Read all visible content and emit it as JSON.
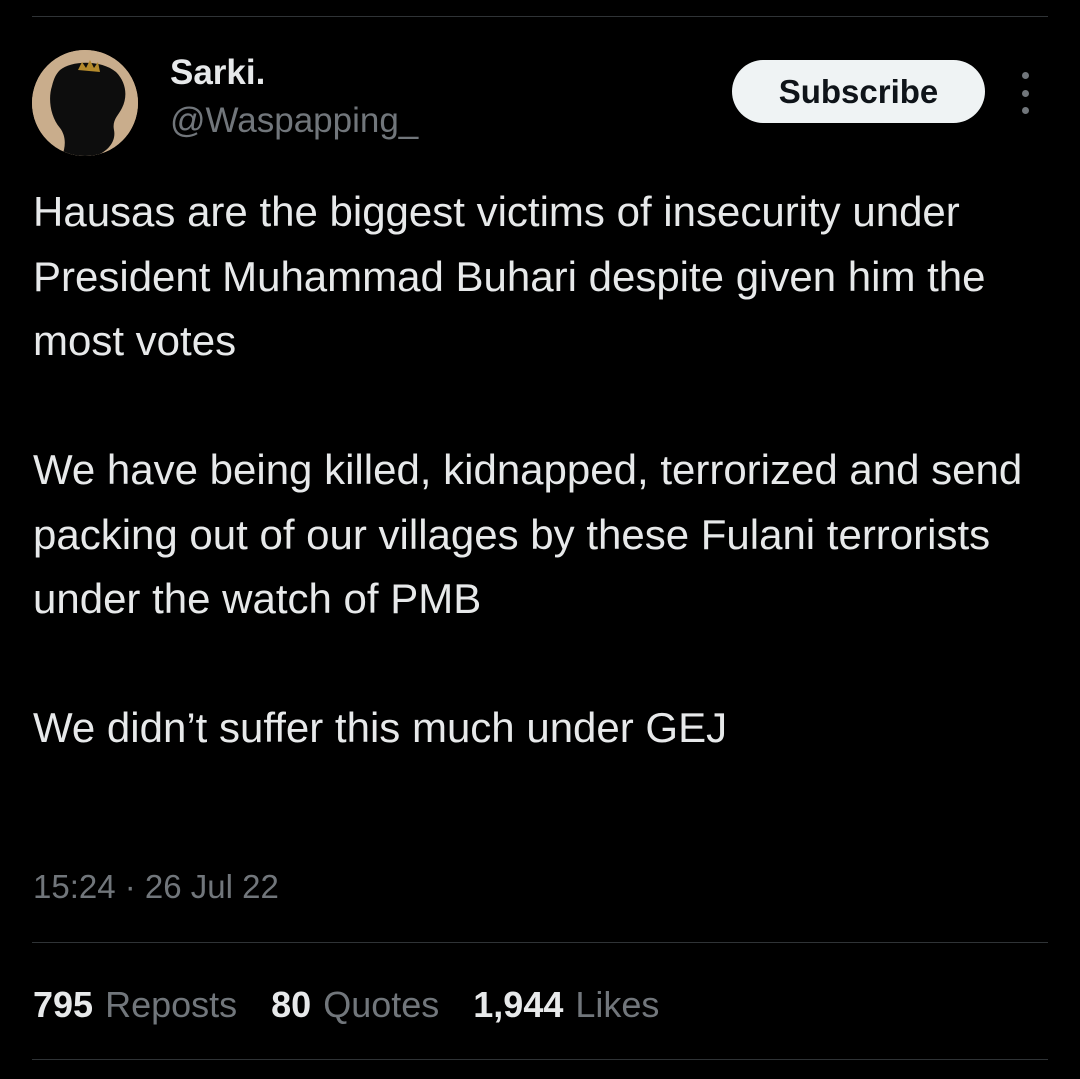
{
  "author": {
    "display_name": "Sarki.",
    "handle": "@Waspapping_"
  },
  "actions": {
    "subscribe_label": "Subscribe",
    "more_icon": "more-vertical-icon"
  },
  "tweet": {
    "paragraphs": [
      "Hausas are the biggest victims of insecurity under President Muhammad Buhari despite given him the most votes",
      "We have being killed, kidnapped, terrorized and send packing out of our villages by these Fulani terrorists under the watch of PMB",
      "We didn’t suffer this much under GEJ"
    ],
    "timestamp": "15:24 · 26 Jul 22"
  },
  "stats": [
    {
      "count": "795",
      "label": "Reposts"
    },
    {
      "count": "80",
      "label": "Quotes"
    },
    {
      "count": "1,944",
      "label": "Likes"
    }
  ],
  "colors": {
    "background": "#000000",
    "text_primary": "#e7e9ea",
    "text_secondary": "#71767b",
    "divider": "#2f3336",
    "button_bg": "#eff3f4",
    "avatar_bg": "#c9ad8c"
  }
}
